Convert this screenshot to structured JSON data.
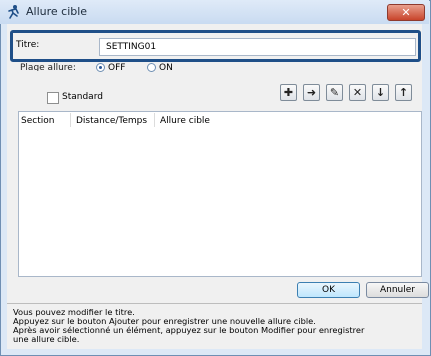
{
  "window": {
    "title": "Allure cible",
    "close_label": "✕"
  },
  "title_field": {
    "label": "Titre:",
    "value": "SETTING01"
  },
  "plage": {
    "label": "Plage allure:",
    "options": [
      "OFF",
      "ON"
    ],
    "selected": "OFF"
  },
  "standard": {
    "label": "Standard",
    "checked": false
  },
  "toolbar": {
    "add": "add-icon",
    "right": "arrow-right-icon",
    "edit": "pencil-icon",
    "delete": "x-icon",
    "down": "arrow-down-icon",
    "up": "arrow-up-icon"
  },
  "table": {
    "columns": [
      "Section",
      "Distance/Temps",
      "Allure cible"
    ],
    "rows": []
  },
  "buttons": {
    "ok": "OK",
    "cancel": "Annuler"
  },
  "help": [
    "Vous pouvez modifier le titre.",
    "Appuyez sur le bouton Ajouter pour enregistrer une nouvelle allure cible.",
    "Après avoir sélectionné un élément, appuyez sur le bouton Modifier pour enregistrer",
    "une allure cible."
  ]
}
